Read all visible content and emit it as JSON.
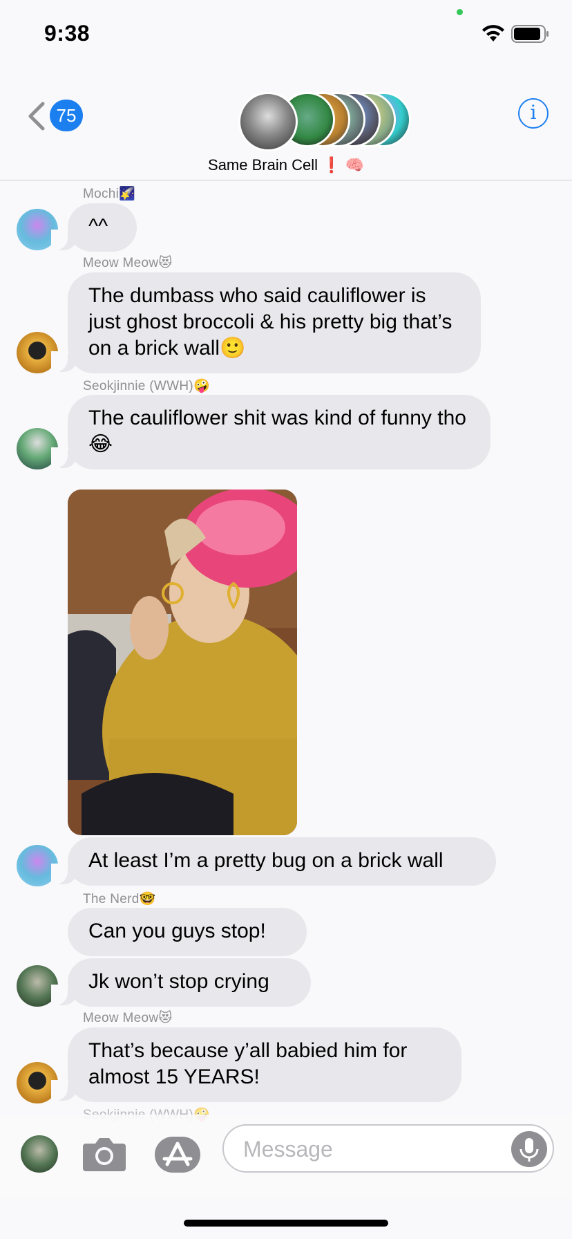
{
  "status_bar": {
    "time": "9:38"
  },
  "nav": {
    "back_badge": "75",
    "group_name": "Same Brain Cell ❗ 🧠",
    "info_label": "i"
  },
  "messages": [
    {
      "sender": "Mochi🌠",
      "text": "^^"
    },
    {
      "sender": "Meow Meow😻",
      "text": "The dumbass who said cauliflower is just ghost broccoli & his pretty big that’s on a brick wall🙂"
    },
    {
      "sender": "Seokjinnie (WWH)🤪",
      "text": "The cauliflower shit was kind of funny tho😂"
    },
    {
      "text": "At least I’m a pretty bug on a brick wall"
    },
    {
      "sender": "The Nerd🤓",
      "text": "Can you guys stop!"
    },
    {
      "text": "Jk won’t stop crying"
    },
    {
      "sender": "Meow Meow😻",
      "text": "That’s because y’all babied him for almost 15 YEARS!"
    },
    {
      "sender": "Seokjinnie (WWH)🤪"
    }
  ],
  "input": {
    "placeholder": "Message"
  },
  "colors": {
    "accent": "#1c7ff0",
    "bubble": "#e8e7ec",
    "background": "#f9f9fb"
  }
}
